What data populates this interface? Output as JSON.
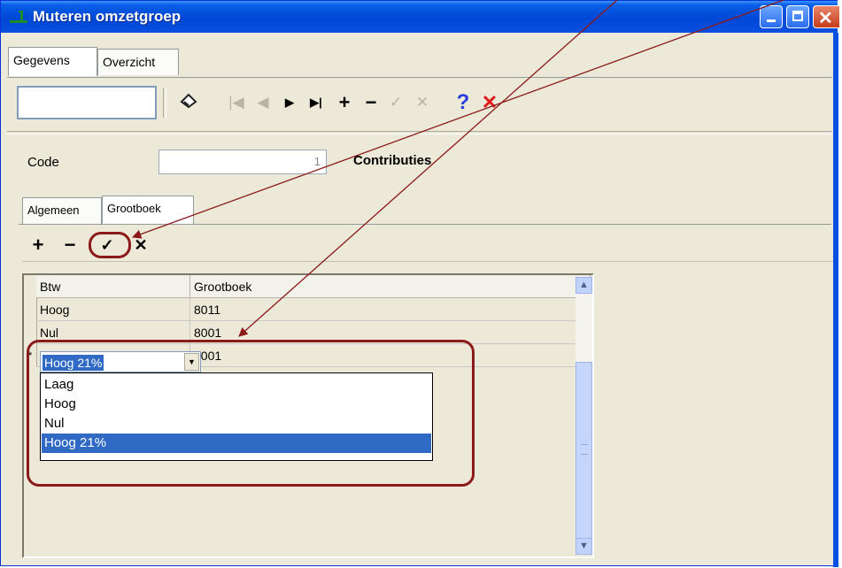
{
  "window": {
    "title": "Muteren omzetgroep",
    "title_bar_color": "#0a5fe8"
  },
  "top_tabs": [
    {
      "label": "Gegevens",
      "active": true
    },
    {
      "label": "Overzicht",
      "active": false
    }
  ],
  "toolbar": {
    "search_value": "",
    "buttons": [
      {
        "name": "lookup",
        "icon": "eraser-icon",
        "enabled": true
      },
      {
        "name": "first-record",
        "icon": "first-icon",
        "enabled": false
      },
      {
        "name": "previous-record",
        "icon": "previous-icon",
        "enabled": false
      },
      {
        "name": "next-record",
        "icon": "next-icon",
        "enabled": true
      },
      {
        "name": "last-record",
        "icon": "last-icon",
        "enabled": true
      },
      {
        "name": "add-record",
        "icon": "plus-icon",
        "enabled": true
      },
      {
        "name": "delete-record",
        "icon": "minus-icon",
        "enabled": true
      },
      {
        "name": "post-record",
        "icon": "check-icon",
        "enabled": false
      },
      {
        "name": "cancel-edit",
        "icon": "x-icon",
        "enabled": false
      },
      {
        "name": "help",
        "icon": "question-icon",
        "enabled": true
      },
      {
        "name": "close",
        "icon": "red-x-icon",
        "enabled": true
      }
    ]
  },
  "header": {
    "code_label": "Code",
    "code_value": "1",
    "description": "Contributies"
  },
  "sub_tabs": [
    {
      "label": "Algemeen",
      "active": false
    },
    {
      "label": "Grootboek",
      "active": true
    }
  ],
  "grid": {
    "toolbar_icons": [
      "plus-icon",
      "minus-icon",
      "check-icon",
      "x-icon"
    ],
    "columns": [
      "Btw",
      "Grootboek"
    ],
    "rows": [
      {
        "btw": "Hoog",
        "grootboek": "8011"
      },
      {
        "btw": "Nul",
        "grootboek": "8001"
      }
    ],
    "editing_row": {
      "indicator": "*",
      "btw": "Hoog 21%",
      "grootboek": "8001"
    },
    "dropdown_options": [
      "Laag",
      "Hoog",
      "Nul",
      "Hoog 21%"
    ],
    "dropdown_selected": "Hoog 21%"
  },
  "colors": {
    "selection": "#316ac5",
    "annotation": "#8b1a1a",
    "cancel_red": "#e01a1a",
    "help_blue": "#2a3ee0"
  }
}
